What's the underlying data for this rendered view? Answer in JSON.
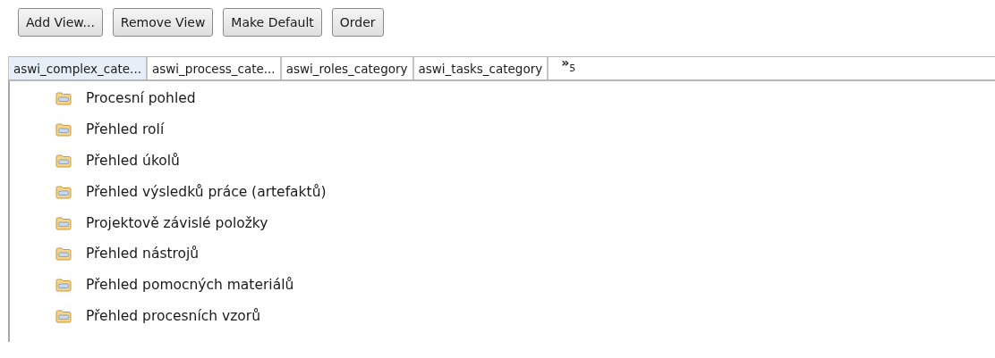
{
  "buttons": [
    "Add View...",
    "Remove View",
    "Make Default",
    "Order"
  ],
  "tabs": [
    {
      "label": "aswi_complex_cate...",
      "selected": true
    },
    {
      "label": "aswi_process_cate...",
      "selected": false
    },
    {
      "label": "aswi_roles_category",
      "selected": false
    },
    {
      "label": "aswi_tasks_category",
      "selected": false
    }
  ],
  "tab_overflow": {
    "glyph": "»",
    "count": "5"
  },
  "tree": [
    {
      "label": "Procesní pohled"
    },
    {
      "label": "Přehled rolí"
    },
    {
      "label": "Přehled úkolů"
    },
    {
      "label": "Přehled výsledků práce (artefaktů)"
    },
    {
      "label": "Projektově závislé položky"
    },
    {
      "label": "Přehled nástrojů"
    },
    {
      "label": "Přehled pomocných materiálů"
    },
    {
      "label": "Přehled procesních vzorů"
    }
  ]
}
